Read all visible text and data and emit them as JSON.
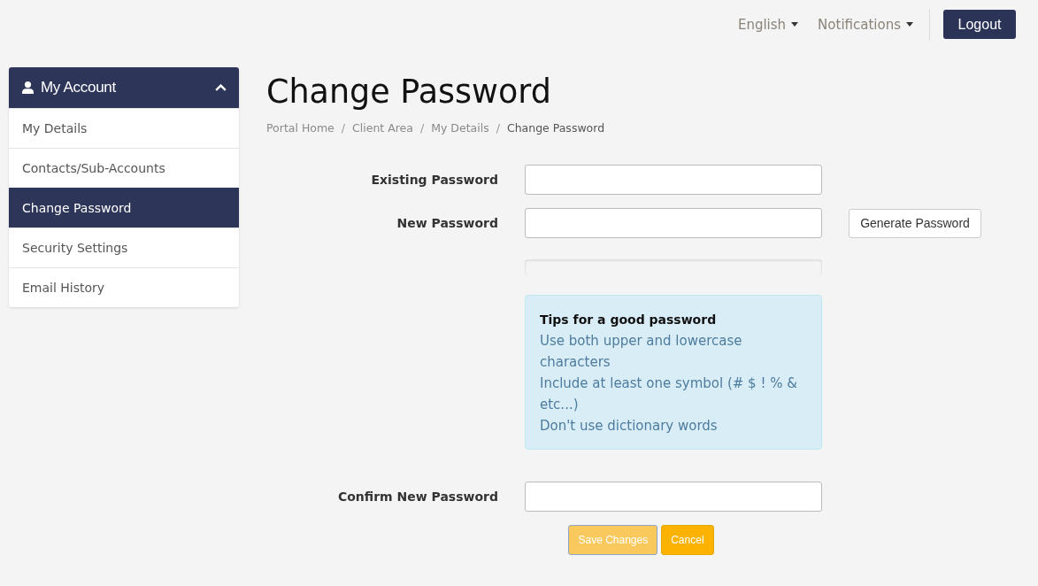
{
  "top_nav": {
    "menus": [
      {
        "label": "English"
      },
      {
        "label": "Notifications"
      }
    ],
    "logout_button": "Logout"
  },
  "sidebar": {
    "title": "My Account",
    "expanded": true,
    "items": [
      {
        "label": "My Details",
        "selected": false
      },
      {
        "label": "Contacts/Sub-Accounts",
        "selected": false
      },
      {
        "label": "Change Password",
        "selected": true
      },
      {
        "label": "Security Settings",
        "selected": false
      },
      {
        "label": "Email History",
        "selected": false
      }
    ]
  },
  "page": {
    "title": "Change Password",
    "breadcrumb": [
      {
        "label": "Portal Home",
        "current": false
      },
      {
        "separator": "/",
        "label": "Client Area",
        "current": false
      },
      {
        "separator": "/",
        "label": "My Details",
        "current": false
      },
      {
        "separator": "/",
        "label": "Change Password",
        "current": true
      }
    ]
  },
  "form": {
    "rows": [
      {
        "kind": "field",
        "label": "Existing Password"
      },
      {
        "kind": "field",
        "label": "New Password",
        "button": "Generate Password"
      },
      {
        "kind": "meter"
      },
      {
        "kind": "tips",
        "title": "Tips for a good password",
        "lines": [
          "Use both upper and lowercase characters",
          "Include at least one symbol (# $ ! % & etc...)",
          "Don't use dictionary words"
        ]
      },
      {
        "kind": "field",
        "label": "Confirm New Password"
      }
    ],
    "buttons": [
      {
        "label": "Save Changes",
        "disabled": true
      },
      {
        "label": "Cancel",
        "disabled": false
      }
    ]
  }
}
